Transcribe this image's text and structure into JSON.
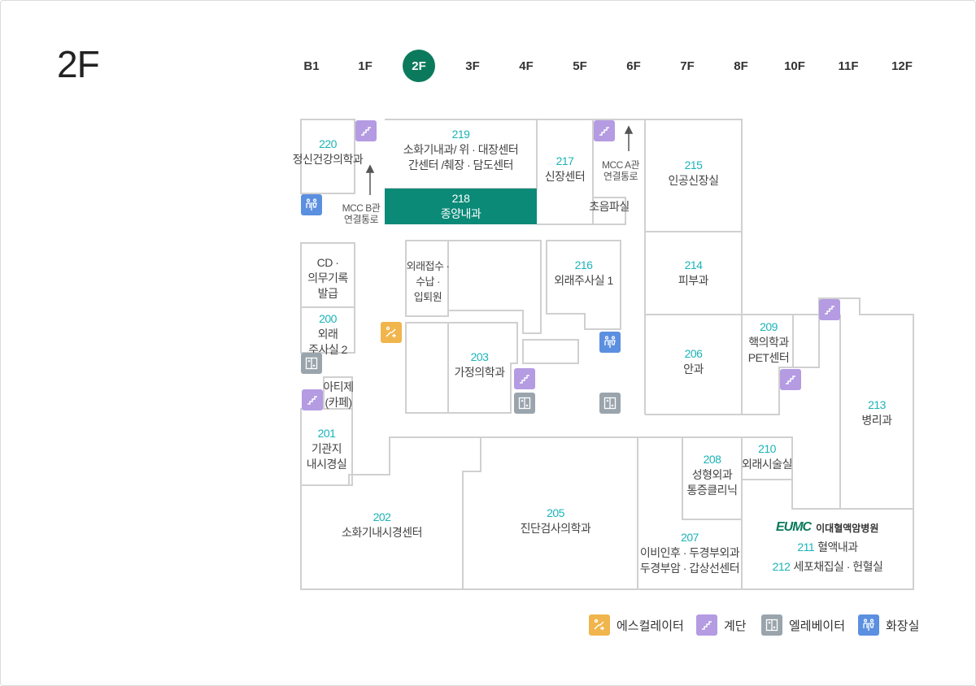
{
  "page": {
    "floor_title": "2F"
  },
  "floor_tabs": [
    "B1",
    "1F",
    "2F",
    "3F",
    "4F",
    "5F",
    "6F",
    "7F",
    "8F",
    "10F",
    "11F",
    "12F"
  ],
  "active_floor": "2F",
  "rooms": {
    "r220": {
      "num": "220",
      "name": "정신건강의학과"
    },
    "r219": {
      "num": "219",
      "name1": "소화기내과/ 위 · 대장센터",
      "name2": "간센터 /췌장 · 담도센터"
    },
    "r218": {
      "num": "218",
      "name": "종양내과"
    },
    "r217": {
      "num": "217",
      "name": "신장센터"
    },
    "r215": {
      "num": "215",
      "name": "인공신장실"
    },
    "ultrasound": {
      "name": "초음파실"
    },
    "cd": {
      "name1": "CD ·",
      "name2": "의무기록",
      "name3": "발급"
    },
    "reception": {
      "name1": "외래접수 ·",
      "name2": "수납 ·",
      "name3": "입퇴원"
    },
    "r216": {
      "num": "216",
      "name": "외래주사실 1"
    },
    "r214": {
      "num": "214",
      "name": "피부과"
    },
    "r200": {
      "num": "200",
      "name1": "외래",
      "name2": "주사실 2"
    },
    "r203": {
      "num": "203",
      "name": "가정의학과"
    },
    "r206": {
      "num": "206",
      "name": "안과"
    },
    "r209": {
      "num": "209",
      "name1": "핵의학과",
      "name2": "PET센터"
    },
    "cafe": {
      "name1": "아티제",
      "name2": "(카페)"
    },
    "r201": {
      "num": "201",
      "name1": "기관지",
      "name2": "내시경실"
    },
    "r213": {
      "num": "213",
      "name": "병리과"
    },
    "r208": {
      "num": "208",
      "name1": "성형외과",
      "name2": "통증클리닉"
    },
    "r210": {
      "num": "210",
      "name": "외래시술실"
    },
    "r202": {
      "num": "202",
      "name": "소화기내시경센터"
    },
    "r205": {
      "num": "205",
      "name": "진단검사의학과"
    },
    "r207": {
      "num": "207",
      "name1": "이비인후 · 두경부외과",
      "name2": "두경부암 · 갑상선센터"
    },
    "r211": {
      "num": "211",
      "name": "혈액내과"
    },
    "r212": {
      "num": "212",
      "name": "세포채집실 · 헌혈실"
    }
  },
  "passages": {
    "mcc_b": {
      "line1": "MCC B관",
      "line2": "연결통로"
    },
    "mcc_a": {
      "line1": "MCC A관",
      "line2": "연결통로"
    }
  },
  "eumc": {
    "logo": "EUMC",
    "text": "이대혈액암병원"
  },
  "legend": [
    {
      "icon": "escalator-icon",
      "label": "에스컬레이터"
    },
    {
      "icon": "stairs-icon",
      "label": "계단"
    },
    {
      "icon": "elevator-icon",
      "label": "엘레베이터"
    },
    {
      "icon": "restroom-icon",
      "label": "화장실"
    }
  ],
  "colors": {
    "accent": "#0b7a5c",
    "room_number": "#1bb3b8",
    "highlight_room": "#0b8a78",
    "stairs": "#b49be2",
    "escalator": "#f0b54c",
    "elevator": "#9aa4ad",
    "restroom": "#5b8fe0",
    "wall": "#d0d0d0"
  }
}
